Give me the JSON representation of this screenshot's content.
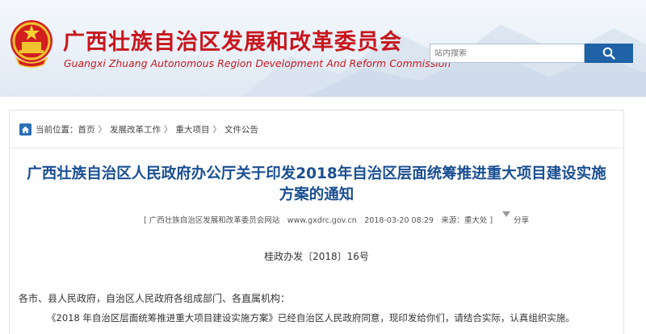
{
  "colors": {
    "brand_red": "#c8161d",
    "title_blue": "#1a4f92",
    "search_button_blue": "#1f62a6"
  },
  "header": {
    "emblem_icon": "national-emblem-icon",
    "site_title": "广西壮族自治区发展和改革委员会",
    "site_subtitle": "Guangxi Zhuang Autonomous Region Development And Reform Commission",
    "search": {
      "placeholder": "站内搜索",
      "value": "",
      "button_icon": "search-icon"
    }
  },
  "breadcrumb": {
    "icon": "home-icon",
    "prefix": "当前位置：",
    "items": [
      "首页",
      "发展改革工作",
      "重大项目",
      "文件公告"
    ],
    "separator": "〉"
  },
  "article": {
    "title": "广西壮族自治区人民政府办公厅关于印发2018年自治区层面统筹推进重大项目建设实施方案的通知",
    "meta": {
      "source": "[ 广西壮族自治区发展和改革委员会网站　www.gxdrc.gov.cn　2018-03-20 08:29　来源：重大处 ]",
      "share_label": "分享"
    },
    "doc_number": "桂政办发〔2018〕16号",
    "paragraphs": [
      "各市、县人民政府，自治区人民政府各组成部门、各直属机构：",
      "《2018 年自治区层面统筹推进重大项目建设实施方案》已经自治区人民政府同意，现印发给你们，请结合实际，认真组织实施。"
    ]
  }
}
